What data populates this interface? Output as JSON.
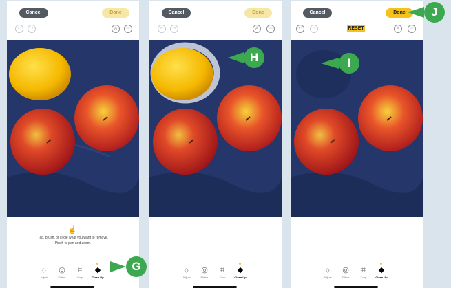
{
  "panels": [
    {
      "cancel_label": "Cancel",
      "done_label": "Done",
      "hint_line1": "Tap, brush, or circle what you want to remove.",
      "hint_line2": "Pinch to pan and zoom.",
      "tools": [
        "Adjust",
        "Filters",
        "Crop",
        "Clean Up"
      ]
    },
    {
      "cancel_label": "Cancel",
      "done_label": "Done",
      "tools": [
        "Adjust",
        "Filters",
        "Crop",
        "Clean Up"
      ]
    },
    {
      "cancel_label": "Cancel",
      "done_label": "Done",
      "reset_label": "RESET",
      "tools": [
        "Adjust",
        "Filters",
        "Crop",
        "Clean Up"
      ]
    }
  ],
  "callouts": {
    "g": "G",
    "h": "H",
    "i": "I",
    "j": "J"
  },
  "colors": {
    "callout": "#3ca84f",
    "done_active": "#f5c21b",
    "background": "#d9e4ec"
  }
}
